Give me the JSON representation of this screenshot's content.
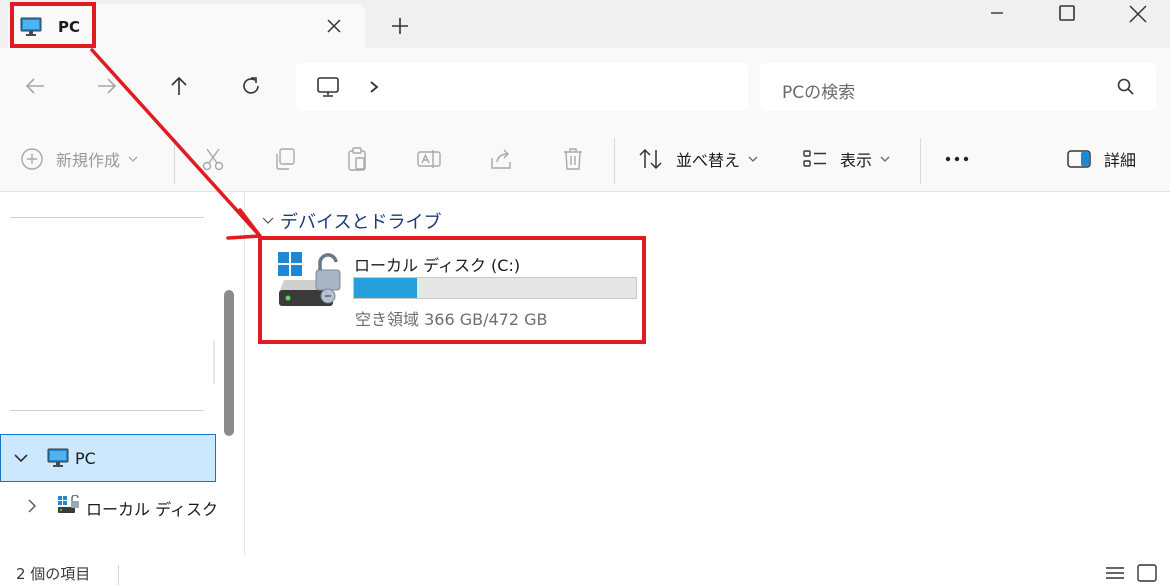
{
  "tab": {
    "title": "PC"
  },
  "search": {
    "placeholder": "PCの検索"
  },
  "toolbar": {
    "new_label": "新規作成",
    "sort_label": "並べ替え",
    "view_label": "表示",
    "details_label": "詳細"
  },
  "sidebar": {
    "items": [
      {
        "label": "PC"
      },
      {
        "label": "ローカル ディスク (C:)"
      }
    ]
  },
  "content": {
    "group_label": "デバイスとドライブ",
    "drive": {
      "name": "ローカル ディスク (C:)",
      "free_text": "空き領域 366 GB/472 GB",
      "used_fraction": 0.225
    }
  },
  "status": {
    "item_count": "2 個の項目"
  },
  "colors": {
    "accent": "#26a0da",
    "annotation": "#e11b22",
    "selection": "#cce8ff"
  },
  "icons": [
    "monitor-icon",
    "close-icon",
    "plus-icon",
    "minimize-icon",
    "maximize-icon",
    "back-arrow-icon",
    "forward-arrow-icon",
    "up-arrow-icon",
    "refresh-icon",
    "chevron-right-icon",
    "search-icon",
    "cut-icon",
    "copy-icon",
    "paste-icon",
    "rename-icon",
    "share-icon",
    "trash-icon",
    "sort-icon",
    "view-icon",
    "more-icon",
    "details-pane-icon",
    "windows-drive-icon",
    "list-view-icon",
    "tile-view-icon"
  ]
}
